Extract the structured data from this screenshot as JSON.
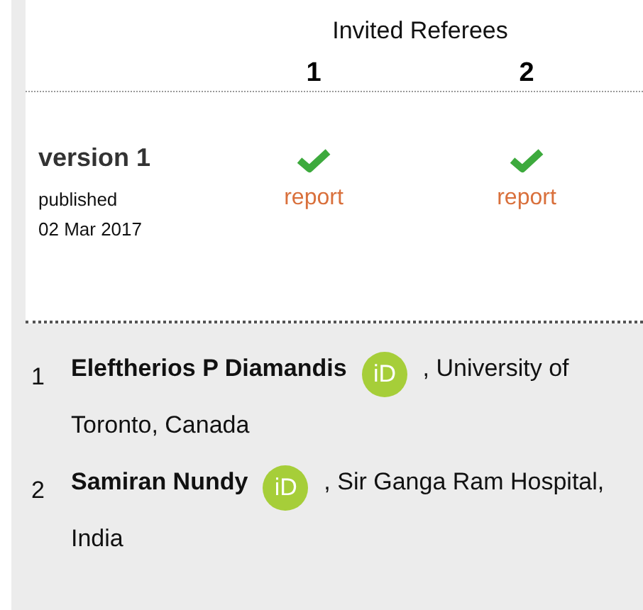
{
  "header": {
    "title": "Invited Referees",
    "referees": [
      "1",
      "2"
    ]
  },
  "versions": [
    {
      "label": "version 1",
      "status": "published",
      "date": "02 Mar 2017",
      "reports": [
        {
          "approved": true,
          "link": "report"
        },
        {
          "approved": true,
          "link": "report"
        }
      ]
    }
  ],
  "authors": [
    {
      "number": "1",
      "name": "Eleftherios P Diamandis",
      "orcid": "iD",
      "affiliation": ", University of Toronto, Canada"
    },
    {
      "number": "2",
      "name": "Samiran Nundy",
      "orcid": "iD",
      "affiliation": ", Sir Ganga Ram Hospital, India"
    }
  ]
}
